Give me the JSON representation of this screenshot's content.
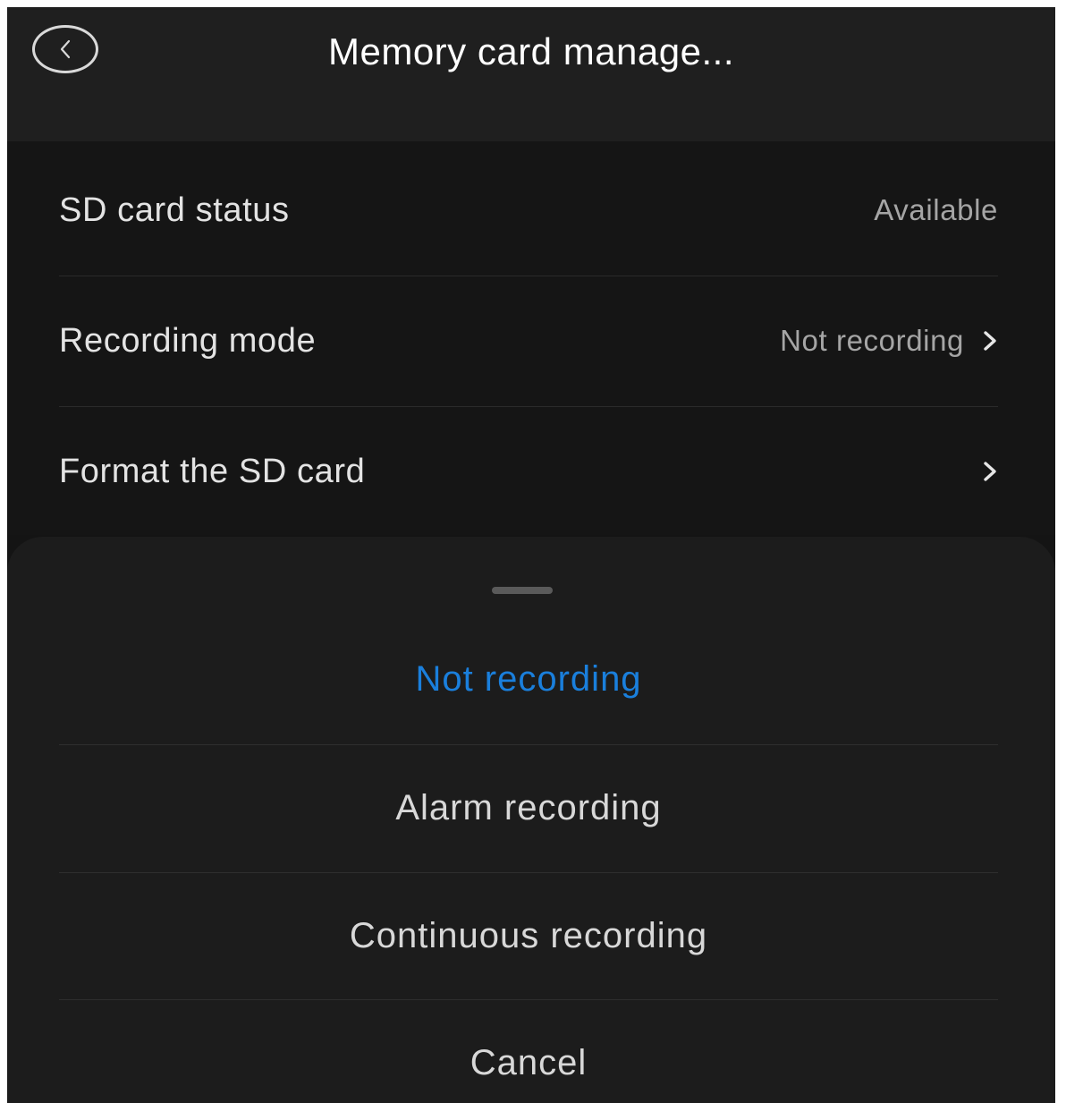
{
  "header": {
    "title": "Memory card manage..."
  },
  "settings": {
    "rows": [
      {
        "label": "SD card status",
        "value": "Available"
      },
      {
        "label": "Recording mode",
        "value": "Not recording"
      },
      {
        "label": "Format the SD card",
        "value": ""
      }
    ]
  },
  "sheet": {
    "options": [
      {
        "label": "Not recording",
        "selected": true
      },
      {
        "label": "Alarm recording",
        "selected": false
      },
      {
        "label": "Continuous recording",
        "selected": false
      }
    ],
    "cancel_label": "Cancel"
  },
  "colors": {
    "accent": "#1a7fdc",
    "background": "#141414"
  }
}
